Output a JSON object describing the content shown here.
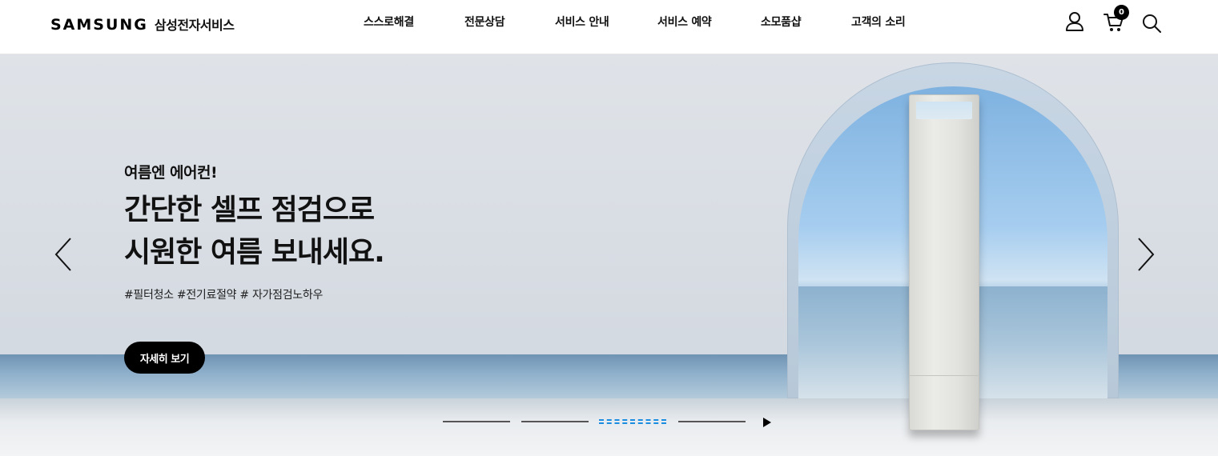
{
  "header": {
    "brand": "SAMSUNG",
    "brand_service": "삼성전자서비스",
    "nav": [
      {
        "label": "스스로해결"
      },
      {
        "label": "전문상담"
      },
      {
        "label": "서비스 안내"
      },
      {
        "label": "서비스 예약"
      },
      {
        "label": "소모품샵"
      },
      {
        "label": "고객의 소리"
      }
    ],
    "cart_count": "0",
    "icons": [
      "user-icon",
      "cart-icon",
      "search-icon"
    ]
  },
  "hero": {
    "subtitle": "여름엔 에어컨!",
    "title_line1": "간단한 셀프 점검으로",
    "title_line2": "시원한 여름 보내세요.",
    "tags": "#필터청소 #전기료절약 # 자가점검노하우",
    "button_label": "자세히 보기",
    "slides_total": 4,
    "active_slide": 3
  },
  "colors": {
    "accent": "#1a8de0",
    "button": "#000000",
    "text": "#111111"
  }
}
